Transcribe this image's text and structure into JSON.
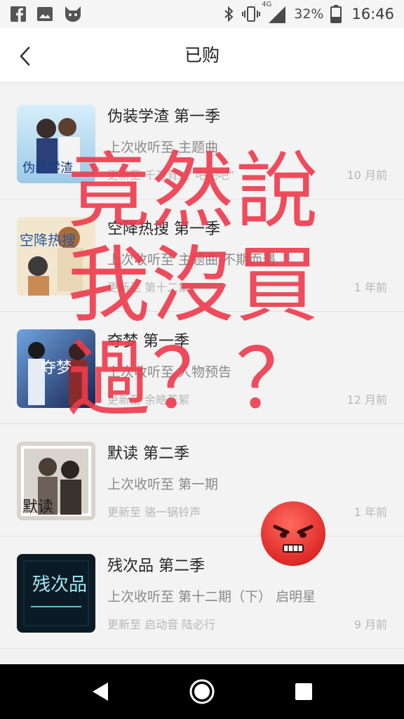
{
  "status_bar": {
    "network_label": "4G",
    "battery": "32%",
    "time": "16:46"
  },
  "header": {
    "title": "已购"
  },
  "items": [
    {
      "title": "伪装学渣 第一季",
      "last_listened": "上次收听至 主题曲",
      "update": "更新至 千万背过“吧吧吧”",
      "time": "10 月前",
      "cover_caption": "伪装学渣",
      "cover_colors": [
        "#bfe3f5",
        "#2f4f8f"
      ]
    },
    {
      "title": "空降热搜 第一季",
      "last_listened": "上次收听至 主题曲 不期而遇",
      "update": "更新至 第十二集",
      "time": "1 年前",
      "cover_caption": "空降热搜",
      "cover_colors": [
        "#f3e6cf",
        "#c98a54"
      ]
    },
    {
      "title": "夺梦 第一季",
      "last_listened": "上次收听至 人物预告",
      "update": "更新至 余皓花絮",
      "time": "12 月前",
      "cover_caption": "夺梦",
      "cover_colors": [
        "#1c2f6e",
        "#6fa4e0"
      ]
    },
    {
      "title": "默读 第二季",
      "last_listened": "上次收听至 第一期",
      "update": "更新至 骆一锅铃声",
      "time": "1 年前",
      "cover_caption": "默读",
      "cover_colors": [
        "#d8d3cc",
        "#5a4e45"
      ]
    },
    {
      "title": "残次品 第二季",
      "last_listened": "上次收听至 第十二期（下） 启明星",
      "update": "更新至 启动音 陆必行",
      "time": "9 月前",
      "cover_caption": "残次品",
      "cover_colors": [
        "#0b1b26",
        "#59c7d6"
      ]
    }
  ],
  "overlay": {
    "lines": [
      "竟然說",
      "我沒買",
      "過？？"
    ],
    "color": "#ee3b4c"
  },
  "icons": {
    "status_left": [
      "facebook-icon",
      "image-icon",
      "cat-app-icon"
    ],
    "status_right": [
      "bluetooth-icon",
      "vibrate-icon",
      "signal-icon",
      "battery-icon"
    ],
    "nav": [
      "back-triangle-icon",
      "home-circle-icon",
      "recents-square-icon"
    ]
  }
}
